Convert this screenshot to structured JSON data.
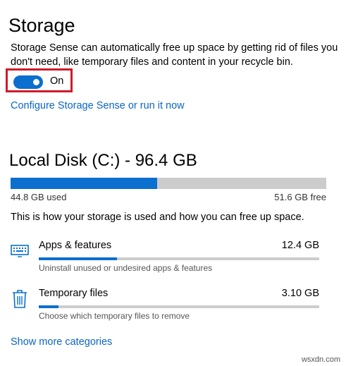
{
  "page": {
    "title": "Storage"
  },
  "storage_sense": {
    "description": "Storage Sense can automatically free up space by getting rid of files you don't need, like temporary files and content in your recycle bin.",
    "toggle": {
      "state": "On",
      "on": true
    },
    "configure_link": "Configure Storage Sense or run it now"
  },
  "disk": {
    "title": "Local Disk (C:) - 96.4 GB",
    "used_label": "44.8 GB used",
    "free_label": "51.6 GB free",
    "used_fraction": 0.465,
    "usage_description": "This is how your storage is used and how you can free up space."
  },
  "categories": [
    {
      "name": "Apps & features",
      "size": "12.4 GB",
      "description": "Uninstall unused or undesired apps & features",
      "bar_fraction": 0.28,
      "icon": "keyboard-icon"
    },
    {
      "name": "Temporary files",
      "size": "3.10 GB",
      "description": "Choose which temporary files to remove",
      "bar_fraction": 0.07,
      "icon": "trash-icon"
    }
  ],
  "show_more_link": "Show more categories",
  "watermark": "wsxdn.com",
  "colors": {
    "accent": "#0b6fce",
    "link": "#0a66c2",
    "highlight_border": "#d11a2a",
    "bar_background": "#cccccc"
  }
}
